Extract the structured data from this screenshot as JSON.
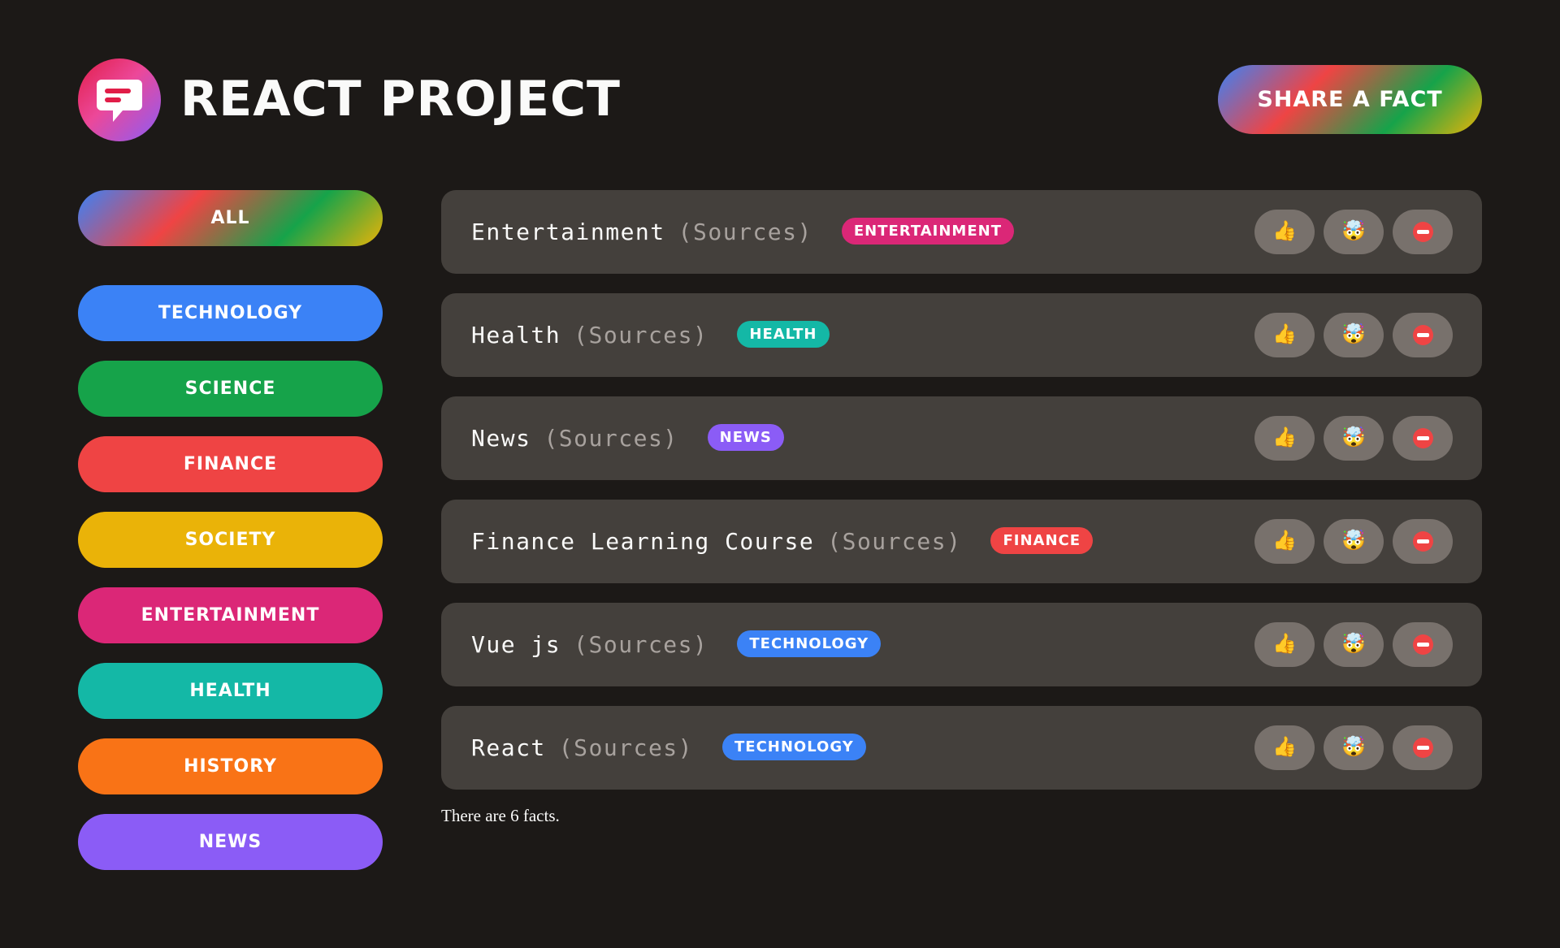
{
  "header": {
    "title": "React Project",
    "share_label": "Share a fact",
    "logo_icon": "speech-bubble-icon"
  },
  "sidebar": {
    "all_label": "All",
    "categories": [
      {
        "label": "Technology",
        "color": "#3b82f6"
      },
      {
        "label": "Science",
        "color": "#16a34a"
      },
      {
        "label": "Finance",
        "color": "#ef4444"
      },
      {
        "label": "Society",
        "color": "#eab308"
      },
      {
        "label": "Entertainment",
        "color": "#db2777"
      },
      {
        "label": "Health",
        "color": "#14b8a6"
      },
      {
        "label": "History",
        "color": "#f97316"
      },
      {
        "label": "News",
        "color": "#8b5cf6"
      }
    ]
  },
  "facts": [
    {
      "text": "Entertainment",
      "source": "(Sources)",
      "tag": "Entertainment",
      "tag_color": "#db2777"
    },
    {
      "text": "Health",
      "source": "(Sources)",
      "tag": "Health",
      "tag_color": "#14b8a6"
    },
    {
      "text": "News",
      "source": "(Sources)",
      "tag": "News",
      "tag_color": "#8b5cf6"
    },
    {
      "text": "Finance Learning Course",
      "source": "(Sources)",
      "tag": "Finance",
      "tag_color": "#ef4444"
    },
    {
      "text": "Vue js",
      "source": "(Sources)",
      "tag": "Technology",
      "tag_color": "#3b82f6"
    },
    {
      "text": "React",
      "source": "(Sources)",
      "tag": "Technology",
      "tag_color": "#3b82f6"
    }
  ],
  "vote_icons": [
    "thumbs-up-icon",
    "mind-blown-icon",
    "no-entry-icon"
  ],
  "footer": {
    "count_text": "There are 6 facts."
  }
}
